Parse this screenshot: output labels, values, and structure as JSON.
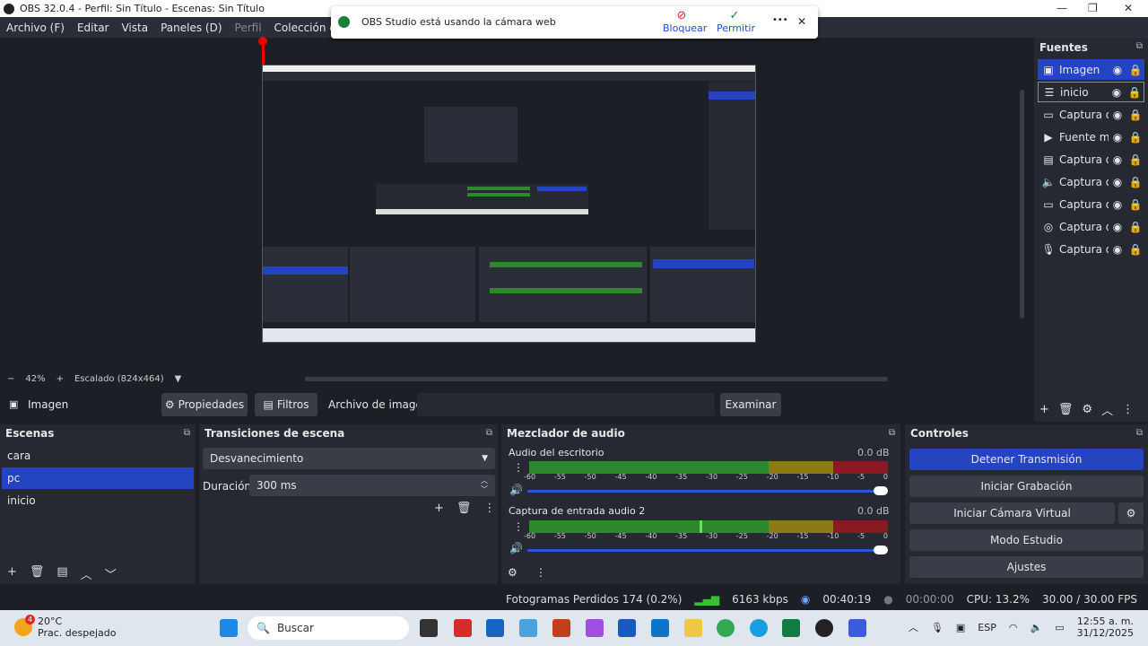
{
  "window": {
    "title": "OBS 32.0.4 - Perfil: Sin Título - Escenas: Sin Título"
  },
  "menu": {
    "items": [
      "Archivo (F)",
      "Editar",
      "Vista",
      "Paneles (D)",
      "Perfil",
      "Colección de Escenas"
    ]
  },
  "notification": {
    "message": "OBS Studio está usando la cámara web",
    "block_label": "Bloquear",
    "allow_label": "Permitir",
    "more_label": "•••",
    "close_label": "✕"
  },
  "zoom": {
    "minus": "−",
    "level": "42%",
    "plus": "+",
    "scale_label": "Escalado (824x464)"
  },
  "sources": {
    "title": "Fuentes",
    "items": [
      {
        "label": "Imagen",
        "icon": "image-icon",
        "glyph": "▣"
      },
      {
        "label": "inicio",
        "icon": "list-icon",
        "glyph": "☰"
      },
      {
        "label": "Captura d",
        "icon": "monitor-icon",
        "glyph": "▭"
      },
      {
        "label": "Fuente m",
        "icon": "play-icon",
        "glyph": "▶"
      },
      {
        "label": "Captura d",
        "icon": "window-icon",
        "glyph": "▤"
      },
      {
        "label": "Captura d",
        "icon": "speaker-icon",
        "glyph": "🔈"
      },
      {
        "label": "Captura d",
        "icon": "monitor-icon",
        "glyph": "▭"
      },
      {
        "label": "Captura d",
        "icon": "gamepad-icon",
        "glyph": "◎"
      },
      {
        "label": "Captura d",
        "icon": "microphone-icon",
        "glyph": "🎙"
      }
    ]
  },
  "source_bar": {
    "current": "Imagen",
    "properties_label": "Propiedades",
    "filters_label": "Filtros",
    "image_file_label": "Archivo de imagen",
    "browse_label": "Examinar"
  },
  "scenes": {
    "title": "Escenas",
    "items": [
      "cara",
      "pc",
      "inicio"
    ],
    "selected": 1
  },
  "transitions": {
    "title": "Transiciones de escena",
    "current": "Desvanecimiento",
    "duration_label": "Duración",
    "duration_value": "300 ms"
  },
  "mixer": {
    "title": "Mezclador de audio",
    "channels": [
      {
        "name": "Audio del escritorio",
        "db": "0.0 dB"
      },
      {
        "name": "Captura de entrada audio 2",
        "db": "0.0 dB"
      }
    ],
    "ticks": [
      "-60",
      "-55",
      "-50",
      "-45",
      "-40",
      "-35",
      "-30",
      "-25",
      "-20",
      "-15",
      "-10",
      "-5",
      "0"
    ]
  },
  "controls": {
    "title": "Controles",
    "stop_stream": "Detener Transmisión",
    "start_recording": "Iniciar Grabación",
    "start_virtual_cam": "Iniciar Cámara Virtual",
    "studio_mode": "Modo Estudio",
    "settings": "Ajustes"
  },
  "status": {
    "dropped_frames": "Fotogramas Perdidos 174 (0.2%)",
    "bitrate": "6163 kbps",
    "stream_time": "00:40:19",
    "rec_time": "00:00:00",
    "cpu": "CPU: 13.2%",
    "fps": "30.00 / 30.00 FPS"
  },
  "taskbar": {
    "temp": "20°C",
    "weather": "Prac. despejado",
    "badge": "4",
    "search": "Buscar",
    "lang": "ESP",
    "time": "12:55 a. m.",
    "date": "31/12/2025"
  },
  "colors": {
    "accent": "#2544c2",
    "background": "#1d1f26",
    "dock": "#262932",
    "meter_green": "#2c8a2c",
    "meter_yellow": "#8a7b16",
    "meter_red": "#8a1a22"
  }
}
